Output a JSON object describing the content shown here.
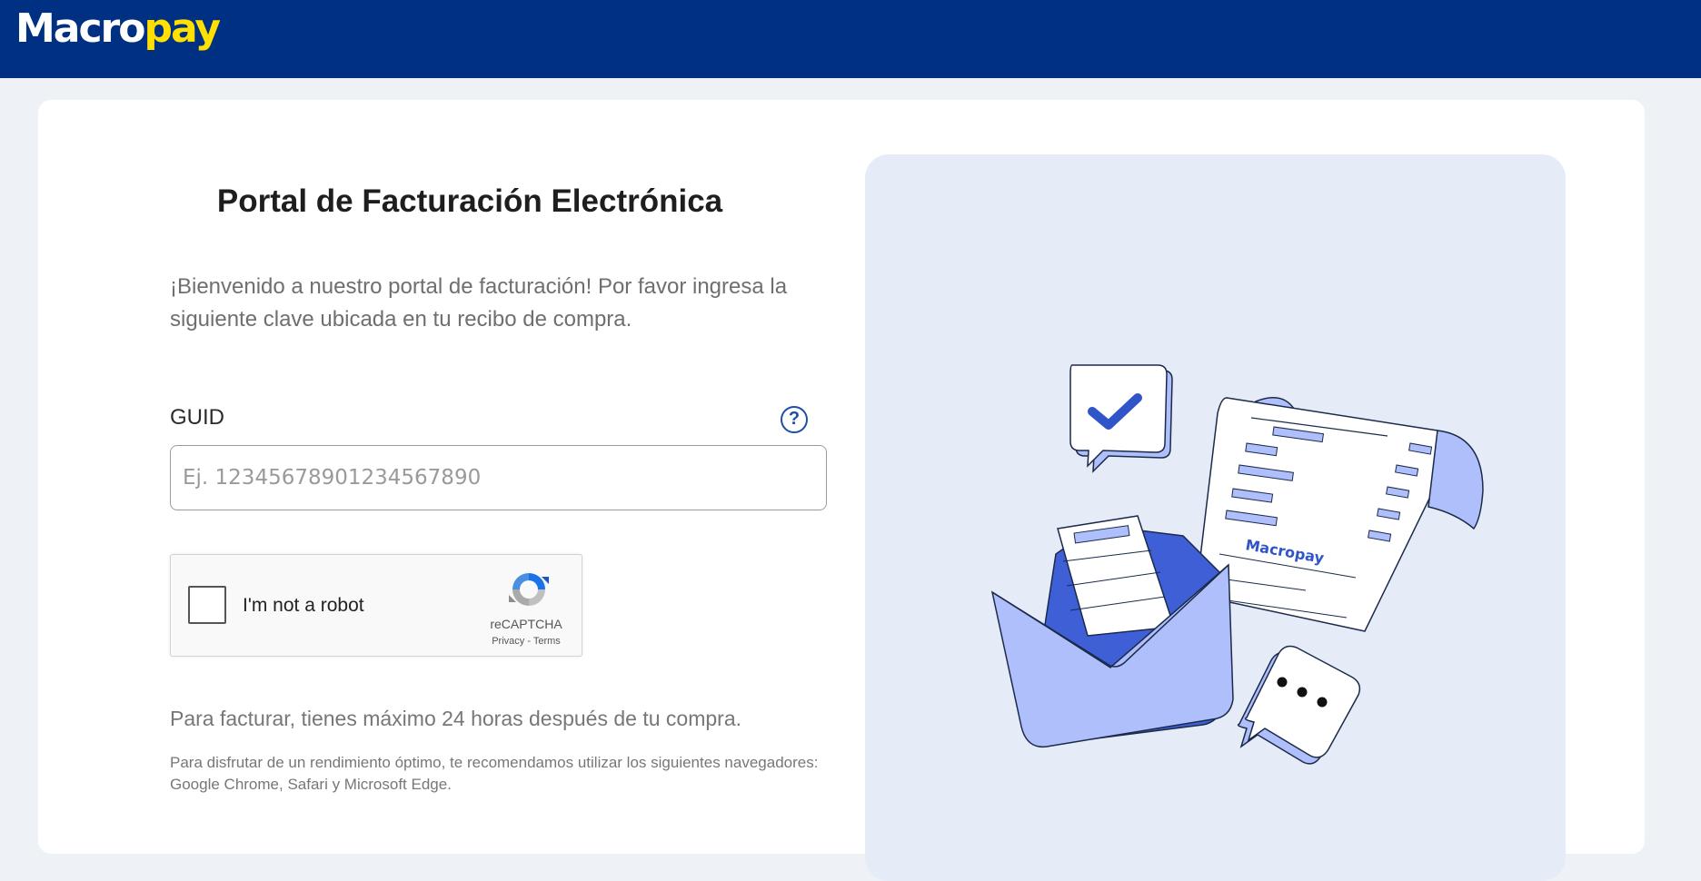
{
  "header": {
    "logo_text_macro": "Macro",
    "logo_text_pay": "pay"
  },
  "form": {
    "title": "Portal de Facturación Electrónica",
    "intro": "¡Bienvenido a nuestro portal de facturación! Por favor ingresa la siguiente clave ubicada en tu recibo de compra.",
    "guid_label": "GUID",
    "help_symbol": "?",
    "guid_placeholder": "Ej. 12345678901234567890",
    "guid_value": ""
  },
  "recaptcha": {
    "label": "I'm not a robot",
    "brand": "reCAPTCHA",
    "privacy": "Privacy",
    "separator": " - ",
    "terms": "Terms",
    "checked": false
  },
  "notes": {
    "deadline": "Para facturar, tienes máximo 24 horas después de tu compra.",
    "browsers": "Para disfrutar de un rendimiento óptimo, te recomendamos utilizar los siguientes navegadores: Google Chrome, Safari y Microsoft Edge."
  },
  "illustration": {
    "receipt_brand": "Macropay"
  },
  "colors": {
    "header_bg": "#003082",
    "brand_yellow": "#ffe000",
    "accent_blue": "#2f55c9",
    "light_blue": "#aebffb",
    "panel_bg": "#e6ecf7",
    "page_bg": "#eef1f5"
  },
  "icons": [
    "macropay-logo",
    "help-circle-icon",
    "recaptcha-logo-icon",
    "checkmark-icon",
    "ellipsis-icon",
    "envelope-icon",
    "receipt-icon"
  ]
}
